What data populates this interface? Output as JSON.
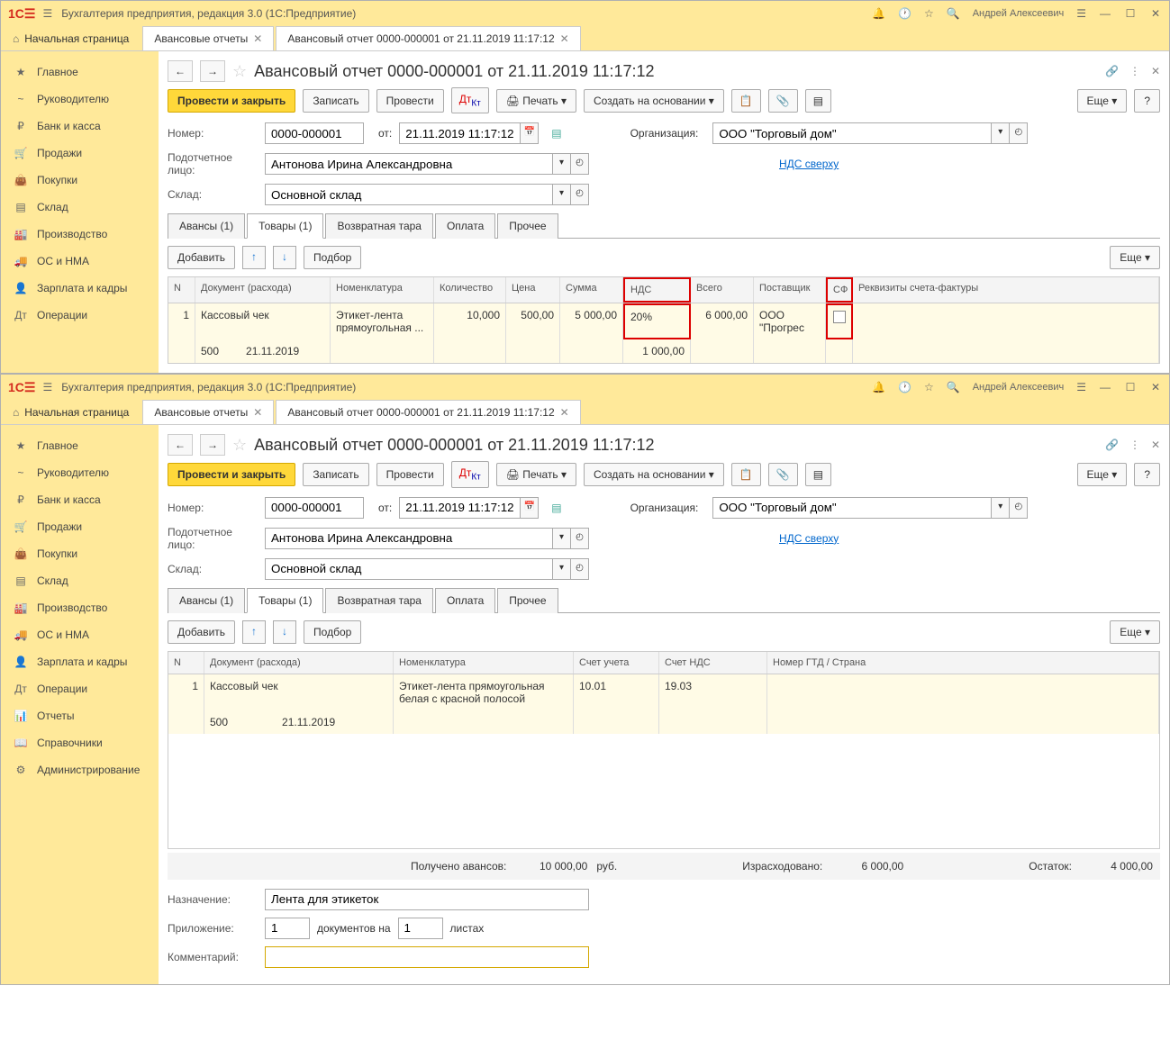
{
  "window1": {
    "title": "Бухгалтерия предприятия, редакция 3.0  (1С:Предприятие)",
    "user": "Андрей Алексеевич",
    "tabs": {
      "home": "Начальная страница",
      "t1": "Авансовые отчеты",
      "t2": "Авансовый отчет 0000-000001 от 21.11.2019 11:17:12"
    },
    "sidebar": [
      "Главное",
      "Руководителю",
      "Банк и касса",
      "Продажи",
      "Покупки",
      "Склад",
      "Производство",
      "ОС и НМА",
      "Зарплата и кадры",
      "Операции"
    ],
    "doc_title": "Авансовый отчет 0000-000001 от 21.11.2019 11:17:12",
    "toolbar": {
      "post_close": "Провести и закрыть",
      "save": "Записать",
      "post": "Провести",
      "print": "Печать",
      "create_based": "Создать на основании",
      "more": "Еще",
      "help": "?"
    },
    "fields": {
      "number_label": "Номер:",
      "number": "0000-000001",
      "from_label": "от:",
      "date": "21.11.2019 11:17:12",
      "org_label": "Организация:",
      "org": "ООО \"Торговый дом\"",
      "person_label": "Подотчетное лицо:",
      "person": "Антонова Ирина Александровна",
      "nds_link": "НДС сверху",
      "warehouse_label": "Склад:",
      "warehouse": "Основной склад"
    },
    "doc_tabs": [
      "Авансы (1)",
      "Товары (1)",
      "Возвратная тара",
      "Оплата",
      "Прочее"
    ],
    "sub_toolbar": {
      "add": "Добавить",
      "select": "Подбор",
      "more": "Еще"
    },
    "table": {
      "headers": [
        "N",
        "Документ (расхода)",
        "Номенклатура",
        "Количество",
        "Цена",
        "Сумма",
        "НДС",
        "Всего",
        "Поставщик",
        "СФ",
        "Реквизиты счета-фактуры"
      ],
      "row": {
        "n": "1",
        "doc": "Кассовый чек",
        "doc_num": "500",
        "doc_date": "21.11.2019",
        "nom": "Этикет-лента прямоугольная ...",
        "qty": "10,000",
        "price": "500,00",
        "sum": "5 000,00",
        "nds": "20%",
        "nds_sum": "1 000,00",
        "total": "6 000,00",
        "supplier": "ООО \"Прогрес"
      }
    }
  },
  "window2": {
    "sidebar": [
      "Главное",
      "Руководителю",
      "Банк и касса",
      "Продажи",
      "Покупки",
      "Склад",
      "Производство",
      "ОС и НМА",
      "Зарплата и кадры",
      "Операции",
      "Отчеты",
      "Справочники",
      "Администрирование"
    ],
    "table": {
      "headers": [
        "N",
        "Документ (расхода)",
        "Номенклатура",
        "Счет учета",
        "Счет НДС",
        "Номер ГТД / Страна"
      ],
      "row": {
        "n": "1",
        "doc": "Кассовый чек",
        "doc_num": "500",
        "doc_date": "21.11.2019",
        "nom": "Этикет-лента прямоугольная белая с красной полосой",
        "acct": "10.01",
        "nds_acct": "19.03"
      }
    },
    "summary": {
      "advance_label": "Получено авансов:",
      "advance": "10 000,00",
      "currency": "руб.",
      "spent_label": "Израсходовано:",
      "spent": "6 000,00",
      "rest_label": "Остаток:",
      "rest": "4 000,00"
    },
    "footer": {
      "purpose_label": "Назначение:",
      "purpose": "Лента для этикеток",
      "attach_label": "Приложение:",
      "attach1": "1",
      "attach_mid": "документов на",
      "attach2": "1",
      "attach_end": "листах",
      "comment_label": "Комментарий:",
      "comment": ""
    }
  }
}
